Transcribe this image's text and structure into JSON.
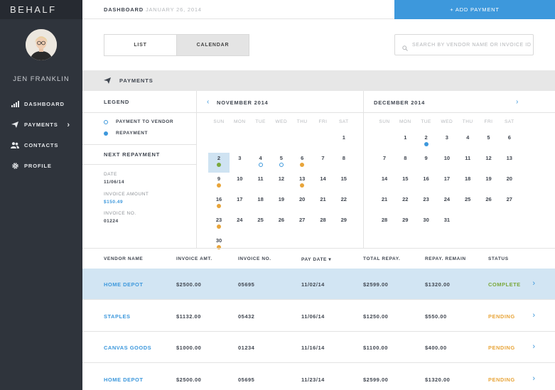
{
  "brand": "BEHALF",
  "user": {
    "name": "JEN FRANKLIN"
  },
  "nav": [
    {
      "label": "DASHBOARD",
      "icon": "chart-icon"
    },
    {
      "label": "PAYMENTS",
      "icon": "paper-plane-icon",
      "chevron": "›"
    },
    {
      "label": "CONTACTS",
      "icon": "people-icon"
    },
    {
      "label": "PROFILE",
      "icon": "gear-icon"
    }
  ],
  "header": {
    "title": "DASHBOARD",
    "date": "JANUARY 26, 2014",
    "add_label": "+ ADD PAYMENT"
  },
  "view_toggle": {
    "list": "LIST",
    "calendar": "CALENDAR",
    "active": "calendar"
  },
  "search": {
    "placeholder": "SEARCH BY VENDOR NAME OR INVOICE ID",
    "icon": "search-icon"
  },
  "payments_title": "PAYMENTS",
  "legend": {
    "title": "LEGEND",
    "items": [
      {
        "label": "PAYMENT TO VENDOR",
        "marker": "outline"
      },
      {
        "label": "REPAYMENT",
        "marker": "filled"
      }
    ]
  },
  "next_repayment": {
    "title": "NEXT REPAYMENT",
    "date_label": "DATE",
    "date": "11/06/14",
    "amount_label": "INVOICE AMOUNT",
    "amount": "$150.49",
    "invoice_label": "INVOICE NO.",
    "invoice": "01224"
  },
  "colors": {
    "accent": "#3d98dc",
    "pending": "#e8a53a",
    "complete": "#7aa83c",
    "sidebar": "#2f343c",
    "selected_row": "#d2e5f3"
  },
  "weekdays": [
    "SUN",
    "MON",
    "TUE",
    "WED",
    "THU",
    "FRI",
    "SAT"
  ],
  "calendars": [
    {
      "title": "NOVEMBER 2014",
      "nav_arrow": "‹",
      "first_weekday": 6,
      "days": 30,
      "selected": 2,
      "markers": {
        "2": "green",
        "4": "outline",
        "5": "outline",
        "6": "orange",
        "9": "orange",
        "13": "orange",
        "16": "orange",
        "23": "orange",
        "30": "orange"
      }
    },
    {
      "title": "DECEMBER 2014",
      "nav_arrow": "›",
      "first_weekday": 1,
      "days": 31,
      "selected": null,
      "markers": {
        "2": "blue"
      }
    }
  ],
  "table": {
    "columns": [
      "VENDOR NAME",
      "INVOICE AMT.",
      "INVOICE NO.",
      "PAY DATE ▾",
      "TOTAL REPAY.",
      "REPAY. REMAIN",
      "STATUS"
    ],
    "rows": [
      {
        "vendor": "HOME DEPOT",
        "amount": "$2500.00",
        "invoice": "05695",
        "pay_date": "11/02/14",
        "total": "$2599.00",
        "remain": "$1320.00",
        "status": "COMPLETE",
        "status_key": "complete"
      },
      {
        "vendor": "STAPLES",
        "amount": "$1132.00",
        "invoice": "05432",
        "pay_date": "11/06/14",
        "total": "$1250.00",
        "remain": "$550.00",
        "status": "PENDING",
        "status_key": "pending"
      },
      {
        "vendor": "CANVAS GOODS",
        "amount": "$1000.00",
        "invoice": "01234",
        "pay_date": "11/16/14",
        "total": "$1100.00",
        "remain": "$400.00",
        "status": "PENDING",
        "status_key": "pending"
      },
      {
        "vendor": "HOME DEPOT",
        "amount": "$2500.00",
        "invoice": "05695",
        "pay_date": "11/23/14",
        "total": "$2599.00",
        "remain": "$1320.00",
        "status": "PENDING",
        "status_key": "pending"
      }
    ],
    "selected_row": 0,
    "row_chevron": "›"
  }
}
